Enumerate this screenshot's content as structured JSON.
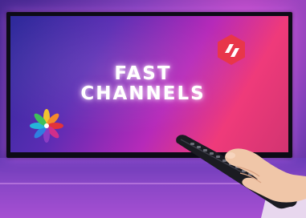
{
  "screen_text": {
    "line1": "FAST",
    "line2": "CHANNELS"
  },
  "logos": {
    "top_right": "hexagon-logo-icon",
    "bottom_left": "pinwheel-flower-logo-icon"
  },
  "colors": {
    "background": "#4a2a94",
    "screen_left": "#2d2a9a",
    "screen_right": "#ef3a7a",
    "hex_logo": "#e8364a",
    "title_text": "#ffffff"
  }
}
